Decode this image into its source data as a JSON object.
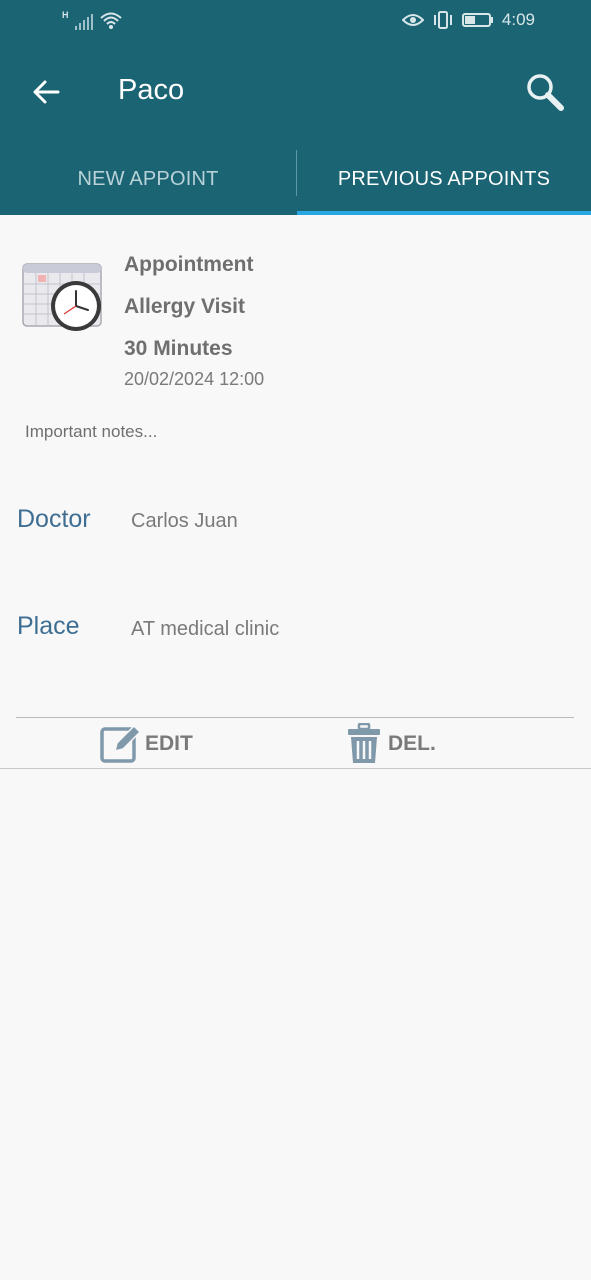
{
  "status_bar": {
    "network": "H",
    "time": "4:09"
  },
  "header": {
    "title": "Paco"
  },
  "tabs": [
    {
      "label": "NEW APPOINT",
      "selected": false
    },
    {
      "label": "PREVIOUS APPOINTS",
      "selected": true
    }
  ],
  "appointment": {
    "type": "Appointment",
    "reason": "Allergy Visit",
    "duration": "30 Minutes",
    "datetime": "20/02/2024 12:00",
    "notes": "Important notes..."
  },
  "details": {
    "doctor_label": "Doctor",
    "doctor_value": "Carlos Juan",
    "place_label": "Place",
    "place_value": "AT medical clinic"
  },
  "actions": {
    "edit_label": "EDIT",
    "delete_label": "DEL."
  },
  "icons": {
    "back": "arrow-left-icon",
    "search": "search-icon",
    "calendar": "calendar-clock-icon",
    "edit": "edit-icon",
    "delete": "trash-icon"
  },
  "colors": {
    "header_bg": "#1b6474",
    "tab_indicator": "#29a7e2",
    "label_blue": "#3f6e93",
    "background": "#f8f8f8"
  }
}
